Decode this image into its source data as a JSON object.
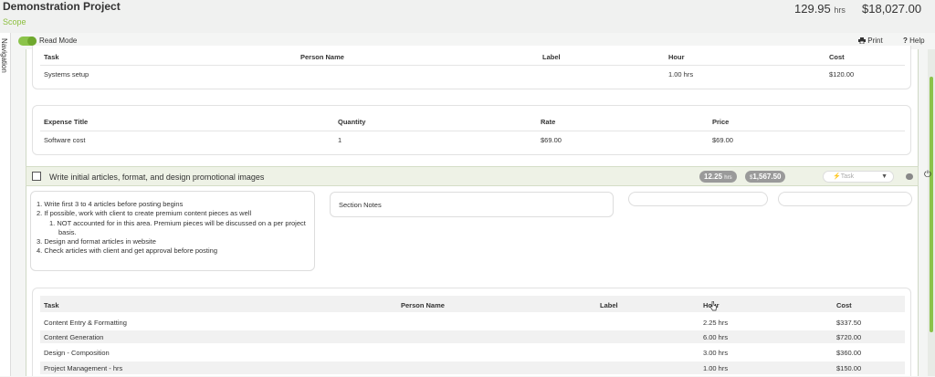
{
  "header": {
    "title": "Demonstration Project",
    "subtitle": "Scope",
    "total_hours": "129.95",
    "hours_unit": "hrs",
    "total_cost": "$18,027.00"
  },
  "navigation": {
    "label": "Navigation"
  },
  "modebar": {
    "read_mode_label": "Read Mode",
    "read_mode_on": true,
    "print_label": "Print",
    "help_label": "Help"
  },
  "task_table_top": {
    "headers": [
      "Task",
      "Person Name",
      "Label",
      "Hour",
      "Cost"
    ],
    "rows": [
      {
        "task": "Systems setup",
        "person": "",
        "label": "",
        "hour": "1.00 hrs",
        "cost": "$120.00"
      }
    ]
  },
  "expense_table": {
    "headers": [
      "Expense Title",
      "Quantity",
      "Rate",
      "Price"
    ],
    "rows": [
      {
        "title": "Software cost",
        "quantity": "1",
        "rate": "$69.00",
        "price": "$69.00"
      }
    ]
  },
  "section": {
    "title": "Write initial articles, format, and design promotional images",
    "hours": "12.25",
    "hours_unit": "hrs",
    "cost_prefix": "$",
    "cost": "1,567.50",
    "type_select": "Task",
    "notes": [
      "1. Write first 3 to 4 articles before posting begins",
      "2. If possible, work with client to create premium content pieces as well",
      "1. NOT accounted for in this area. Premium pieces will be discussed on a per project",
      "basis.",
      "3. Design and format articles in website",
      "4. Check articles with client and get approval before posting"
    ],
    "section_notes_label": "Section Notes"
  },
  "task_table_bottom": {
    "headers": [
      "Task",
      "Person Name",
      "Label",
      "Hour",
      "Cost"
    ],
    "rows": [
      {
        "task": "Content Entry & Formatting",
        "person": "",
        "label": "",
        "hour": "2.25 hrs",
        "cost": "$337.50"
      },
      {
        "task": "Content Generation",
        "person": "",
        "label": "",
        "hour": "6.00 hrs",
        "cost": "$720.00"
      },
      {
        "task": "Design - Composition",
        "person": "",
        "label": "",
        "hour": "3.00 hrs",
        "cost": "$360.00"
      },
      {
        "task": "Project Management - hrs",
        "person": "",
        "label": "",
        "hour": "1.00 hrs",
        "cost": "$150.00"
      }
    ]
  },
  "colors": {
    "accent": "#8bc34a",
    "section_bar": "#eef2e6",
    "pill": "#9a9a9a"
  }
}
